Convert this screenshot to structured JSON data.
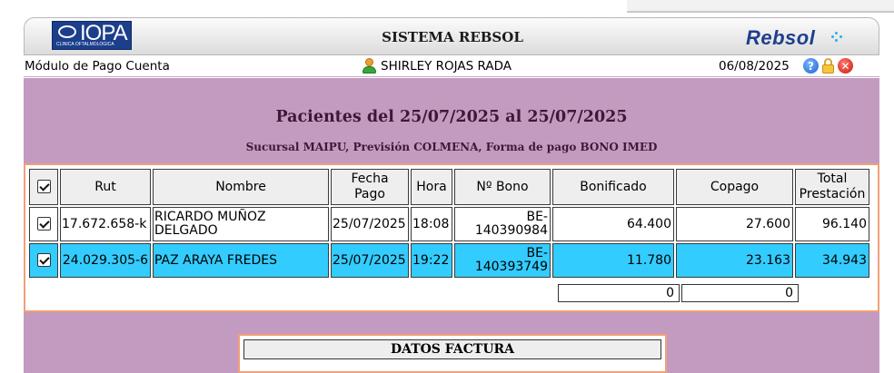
{
  "header": {
    "logo_left": {
      "name": "IOPA",
      "tagline": "CLINICA OFTALMOLOGICA"
    },
    "title": "SISTEMA REBSOL",
    "logo_right": "Rebsol"
  },
  "infobar": {
    "module": "Módulo de Pago Cuenta",
    "user": "SHIRLEY ROJAS RADA",
    "date": "06/08/2025",
    "icons": [
      "help-icon",
      "lock-icon",
      "close-icon"
    ]
  },
  "report": {
    "title": "Pacientes del 25/07/2025 al 25/07/2025",
    "subtitle": "Sucursal MAIPU, Previsión COLMENA, Forma de pago BONO IMED"
  },
  "table": {
    "headers": {
      "rut": "Rut",
      "nombre": "Nombre",
      "fecha_1": "Fecha",
      "fecha_2": "Pago",
      "hora": "Hora",
      "bono": "Nº Bono",
      "bonificado": "Bonificado",
      "copago": "Copago",
      "total_1": "Total",
      "total_2": "Prestación"
    },
    "rows": [
      {
        "checked": true,
        "selected": false,
        "rut": "17.672.658-k",
        "nombre": "RICARDO MUÑOZ DELGADO",
        "fecha": "25/07/2025",
        "hora": "18:08",
        "bono": "BE-140390984",
        "bonificado": "64.400",
        "copago": "27.600",
        "total": "96.140"
      },
      {
        "checked": true,
        "selected": true,
        "rut": "24.029.305-6",
        "nombre": "PAZ ARAYA FREDES",
        "fecha": "25/07/2025",
        "hora": "19:22",
        "bono": "BE-140393749",
        "bonificado": "11.780",
        "copago": "23.163",
        "total": "34.943"
      }
    ],
    "totals": {
      "bonificado": "0",
      "copago": "0"
    }
  },
  "factura": {
    "title": "DATOS FACTURA"
  },
  "colors": {
    "content_bg": "#c39bc0",
    "selected_row": "#33ccff",
    "panel_border": "#f0a078",
    "heading_text": "#3d1838"
  }
}
